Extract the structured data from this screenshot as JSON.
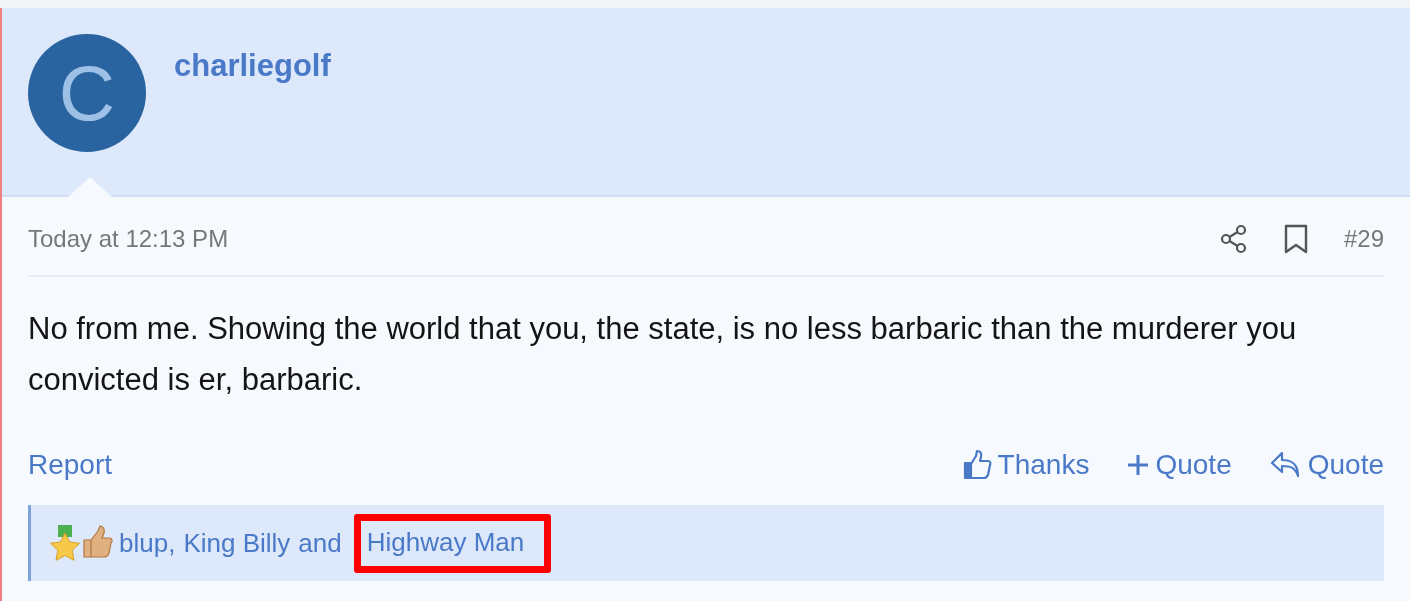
{
  "post": {
    "author": {
      "name": "charliegolf",
      "avatar_letter": "C"
    },
    "date": "Today at 12:13 PM",
    "number": "#29",
    "body": "No from me. Showing the world that you, the state, is no less barbaric than the murderer you convicted is er, barbaric.",
    "report": "Report",
    "actions": [
      {
        "kind": "like",
        "label": "Thanks"
      },
      {
        "kind": "multiquote",
        "label": "Quote"
      },
      {
        "kind": "reply",
        "label": "Quote"
      }
    ],
    "reactions": {
      "users": [
        {
          "name": "blup",
          "highlighted": false
        },
        {
          "name": "King Billy",
          "highlighted": false
        },
        {
          "name": "Highway Man",
          "highlighted": true
        }
      ],
      "separator": ",",
      "conjunction": "and"
    }
  }
}
